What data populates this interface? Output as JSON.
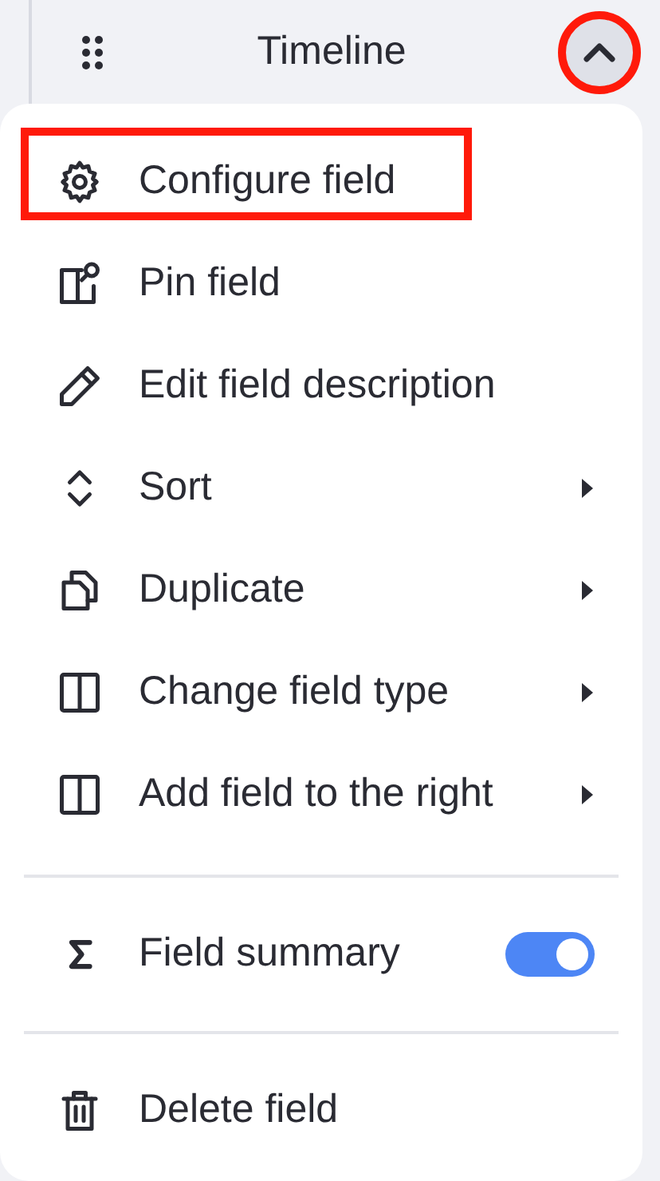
{
  "header": {
    "title": "Timeline",
    "menu_open": true,
    "annotated": true
  },
  "menu": {
    "groups": [
      [
        {
          "kind": "action",
          "label": "Configure field",
          "annotated": true
        },
        {
          "kind": "action",
          "label": "Pin field",
          "annotated": false
        },
        {
          "kind": "action",
          "label": "Edit field description",
          "annotated": false
        },
        {
          "kind": "submenu",
          "label": "Sort",
          "annotated": false
        },
        {
          "kind": "submenu",
          "label": "Duplicate",
          "annotated": false
        },
        {
          "kind": "submenu",
          "label": "Change field type",
          "annotated": false
        },
        {
          "kind": "submenu",
          "label": "Add field to the right",
          "annotated": false
        }
      ],
      [
        {
          "kind": "toggle",
          "label": "Field summary",
          "on": true,
          "annotated": false
        }
      ],
      [
        {
          "kind": "action",
          "label": "Delete field",
          "annotated": false
        }
      ]
    ]
  }
}
